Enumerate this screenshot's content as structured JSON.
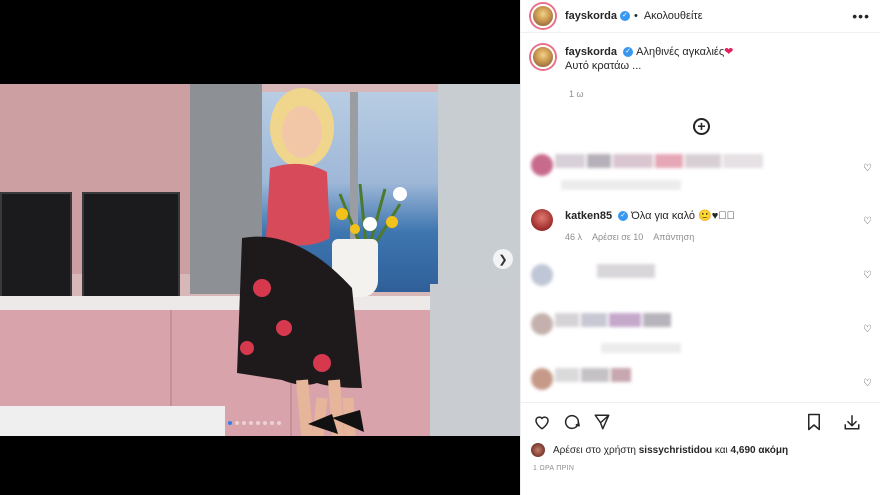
{
  "post": {
    "username": "fayskorda",
    "follow_label": "Ακολουθείτε",
    "more_label": "•••",
    "caption_line1": "Αληθινές αγκαλιές",
    "caption_line2": "Αυτό κρατάω ...",
    "caption_time": "1 ω",
    "heart_emoji": "❤",
    "add_label": "+"
  },
  "comment": {
    "username": "katken85",
    "text": "Όλα για καλό",
    "emojis": "🙂♥🏻🏻",
    "meta_time": "46 λ",
    "meta_likes": "Αρέσει σε 10",
    "reply_label": "Απάντηση"
  },
  "likes": {
    "prefix": "Αρέσει στο χρήστη",
    "user": "sissychristidou",
    "suffix": "και",
    "count": "4,690 ακόμη"
  },
  "post_time": "1 ΩΡΑ ΠΡΙΝ",
  "colors": {
    "accent_blue": "#3897f0",
    "heart_red": "#e0245e",
    "carousel_active": "#2b82f6"
  },
  "icons": {
    "like": "heart-icon",
    "comment": "comment-icon",
    "share": "send-icon",
    "save": "bookmark-icon",
    "download": "download-icon",
    "more": "more-icon",
    "add": "add-comment-icon",
    "next": "chevron-right-icon"
  },
  "carousel": {
    "current": 1,
    "total": 8
  }
}
